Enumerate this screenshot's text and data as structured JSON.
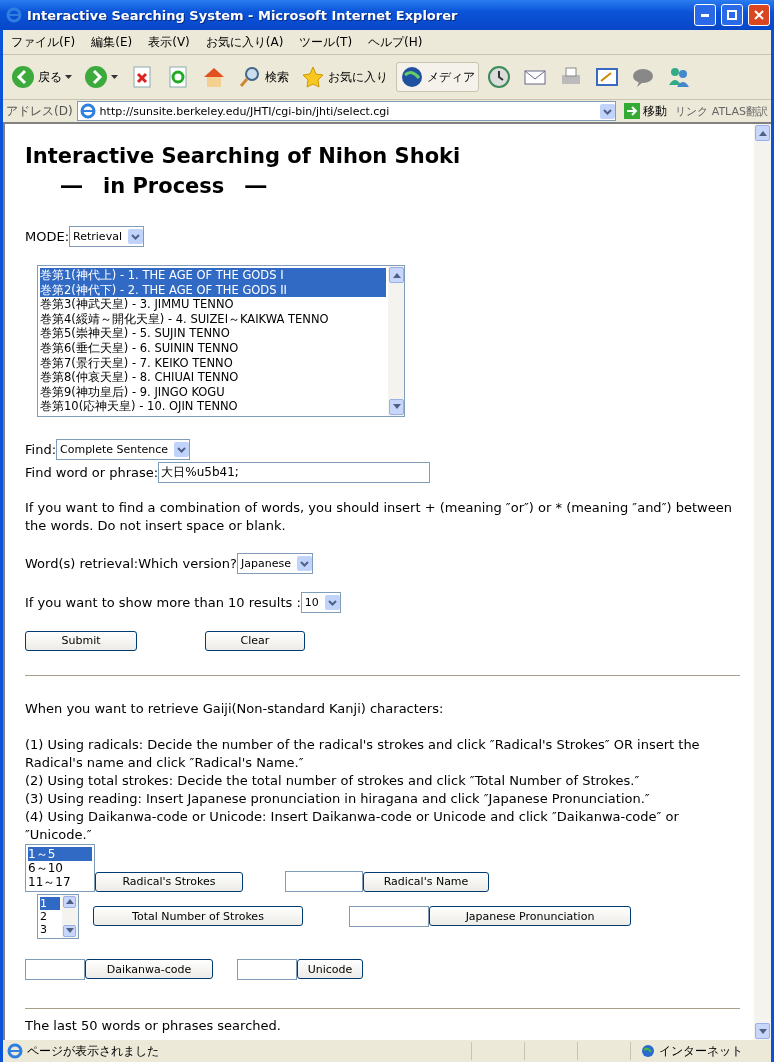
{
  "window": {
    "title": "Interactive Searching System - Microsoft Internet Explorer"
  },
  "menu": [
    "ファイル(F)",
    "編集(E)",
    "表示(V)",
    "お気に入り(A)",
    "ツール(T)",
    "ヘルプ(H)"
  ],
  "toolbar": [
    {
      "kind": "back",
      "label": "戻る"
    },
    {
      "kind": "forward"
    },
    {
      "kind": "stop"
    },
    {
      "kind": "refresh"
    },
    {
      "kind": "home"
    },
    {
      "kind": "search",
      "label": "検索"
    },
    {
      "kind": "favorites",
      "label": "お気に入り"
    },
    {
      "kind": "media",
      "label": "メディア"
    },
    {
      "kind": "history"
    },
    {
      "kind": "mail"
    },
    {
      "kind": "print"
    },
    {
      "kind": "edit"
    },
    {
      "kind": "discuss"
    },
    {
      "kind": "messenger"
    }
  ],
  "address": {
    "label": "アドレス(D)",
    "url": "http://sunsite.berkeley.edu/JHTI/cgi-bin/jhti/select.cgi",
    "go": "移動",
    "links": "リンク",
    "extra": "ATLAS翻訳"
  },
  "page": {
    "title": "Interactive Searching of Nihon Shoki",
    "subtitle": "―　in Process　―",
    "mode": {
      "label": "MODE:",
      "value": "Retrieval"
    },
    "chapters": [
      {
        "label": "巻第1(神代上) - 1. THE AGE OF THE GODS I",
        "selected": true
      },
      {
        "label": "巻第2(神代下) - 2. THE AGE OF THE GODS II",
        "selected": true
      },
      {
        "label": "巻第3(神武天皇) - 3. JIMMU TENNO",
        "selected": false
      },
      {
        "label": "巻第4(綏靖～開化天皇) - 4. SUIZEI～KAIKWA TENNO",
        "selected": false
      },
      {
        "label": "巻第5(崇神天皇) - 5. SUJIN TENNO",
        "selected": false
      },
      {
        "label": "巻第6(垂仁天皇) - 6. SUININ TENNO",
        "selected": false
      },
      {
        "label": "巻第7(景行天皇) - 7. KEIKO TENNO",
        "selected": false
      },
      {
        "label": "巻第8(仲哀天皇) - 8. CHIUAI TENNO",
        "selected": false
      },
      {
        "label": "巻第9(神功皇后) - 9. JINGO KOGU",
        "selected": false
      },
      {
        "label": "巻第10(応神天皇) - 10. OJIN TENNO",
        "selected": false
      }
    ],
    "find": {
      "label": "Find:",
      "value": "Complete Sentence"
    },
    "phrase": {
      "label": "Find word or phrase:",
      "value": "大日%u5b41;"
    },
    "hint": "If you want to find a combination of words, you should insert + (meaning ″or″) or * (meaning ″and″) between the words. Do not insert space or blank.",
    "version": {
      "label": "Word(s) retrieval:Which version?",
      "value": "Japanese"
    },
    "results": {
      "label": "If you want to show more than 10 results :",
      "value": "10"
    },
    "buttons": [
      "Submit",
      "Clear"
    ],
    "gaiji_intro": "When you want to retrieve Gaiji(Non-standard Kanji) characters:",
    "steps": [
      "(1) Using radicals: Decide the number of the radical's strokes and click ″Radical's Strokes″ OR insert the Radical's name and click ″Radical's Name.″",
      "(2) Using total strokes: Decide the total number of strokes and click ″Total Number of Strokes.″",
      "(3) Using reading: Insert Japanese pronunciation in hiragana and click ″Japanese Pronunciation.″",
      "(4) Using Daikanwa-code or Unicode: Insert Daikanwa-code or Unicode and click ″Daikanwa-code″ or ″Unicode.″"
    ],
    "radical_ranges": [
      {
        "label": "1～5",
        "selected": true
      },
      {
        "label": "6～10",
        "selected": false
      },
      {
        "label": "11～17",
        "selected": false
      }
    ],
    "radical_strokes_button": "Radical's Strokes",
    "radical_name_button": "Radical's Name",
    "stroke_numbers": [
      {
        "label": "1",
        "selected": true
      },
      {
        "label": "2",
        "selected": false
      },
      {
        "label": "3",
        "selected": false
      }
    ],
    "total_strokes_button": "Total Number of Strokes",
    "pronunciation_button": "Japanese Pronunciation",
    "daikanwa_button": "Daikanwa-code",
    "unicode_button": "Unicode",
    "last_searched": "The last 50 words or phrases searched."
  },
  "status_bar": {
    "text": "ページが表示されました",
    "zone": "インターネット"
  }
}
